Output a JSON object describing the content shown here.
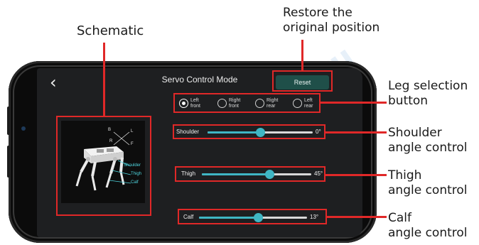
{
  "callouts": {
    "restore": [
      "Restore the",
      "original position"
    ],
    "schematic": "Schematic",
    "leg_selection": [
      "Leg selection",
      "button"
    ],
    "shoulder": [
      "Shoulder",
      "angle control"
    ],
    "thigh": [
      "Thigh",
      "angle control"
    ],
    "calf": [
      "Calf",
      "angle control"
    ]
  },
  "app": {
    "back_icon": "chevron-left-icon",
    "title": "Servo Control Mode",
    "reset_label": "Reset"
  },
  "legs": [
    {
      "line1": "Left",
      "line2": "front",
      "selected": true
    },
    {
      "line1": "Right",
      "line2": "front",
      "selected": false
    },
    {
      "line1": "Right",
      "line2": "rear",
      "selected": false
    },
    {
      "line1": "Left",
      "line2": "rear",
      "selected": false
    }
  ],
  "sliders": [
    {
      "label": "Shoulder",
      "value_text": "0°",
      "fraction": 0.5
    },
    {
      "label": "Thigh",
      "value_text": "45°",
      "fraction": 0.62
    },
    {
      "label": "Calf",
      "value_text": "13°",
      "fraction": 0.55
    }
  ],
  "schematic": {
    "axes": {
      "b": "B",
      "l": "L",
      "r": "R",
      "f": "F"
    },
    "tags": {
      "shoulder": "Shoulder",
      "thigh": "Thigh",
      "calf": "Calf"
    }
  },
  "colors": {
    "accent": "#3fb6c4",
    "highlight": "#e02828",
    "reset_button": "#1f4f49",
    "screen_bg": "#1e1f21"
  }
}
